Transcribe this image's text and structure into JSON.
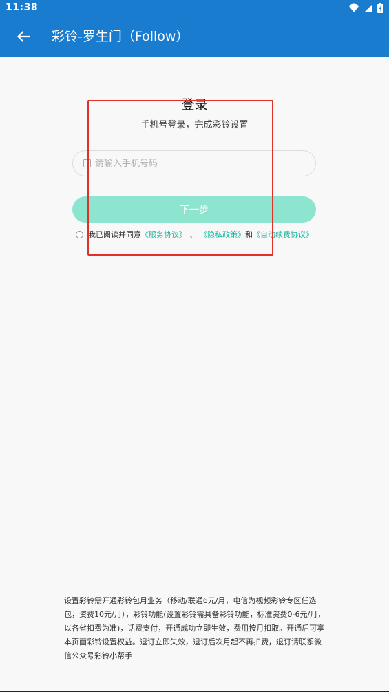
{
  "status_bar": {
    "time": "11:38",
    "icons": [
      "wifi-icon",
      "signal-icon",
      "battery-icon"
    ]
  },
  "app_bar": {
    "back_icon": "arrow-left-icon",
    "title": "彩铃-罗生门（Follow）"
  },
  "login": {
    "title": "登录",
    "subtitle": "手机号登录，完成彩铃设置",
    "phone_placeholder": "请输入手机号码",
    "phone_value": "",
    "next_label": "下一步"
  },
  "agreement": {
    "prefix": "我已阅读并同意",
    "service": "《服务协议》",
    "sep": "、",
    "privacy": "《隐私政策》",
    "and": "和",
    "auto_renew": "《自动续费协议》"
  },
  "footer": {
    "notice": "设置彩铃需开通彩铃包月业务（移动/联通6元/月，电信为视频彩铃专区任选包，资费10元/月），彩铃功能(设置彩铃需具备彩铃功能，标准资费0-6元/月，以各省扣费为准)，话费支付，开通成功立即生效，费用按月扣取。开通后可享本页面彩铃设置权益。退订立即失效，退订后次月起不再扣费，退订请联系微信公众号彩铃小帮手"
  },
  "colors": {
    "primary": "#1a7ccf",
    "button": "#8de5d0",
    "link": "#16b9a0",
    "highlight": "#e0302a"
  }
}
